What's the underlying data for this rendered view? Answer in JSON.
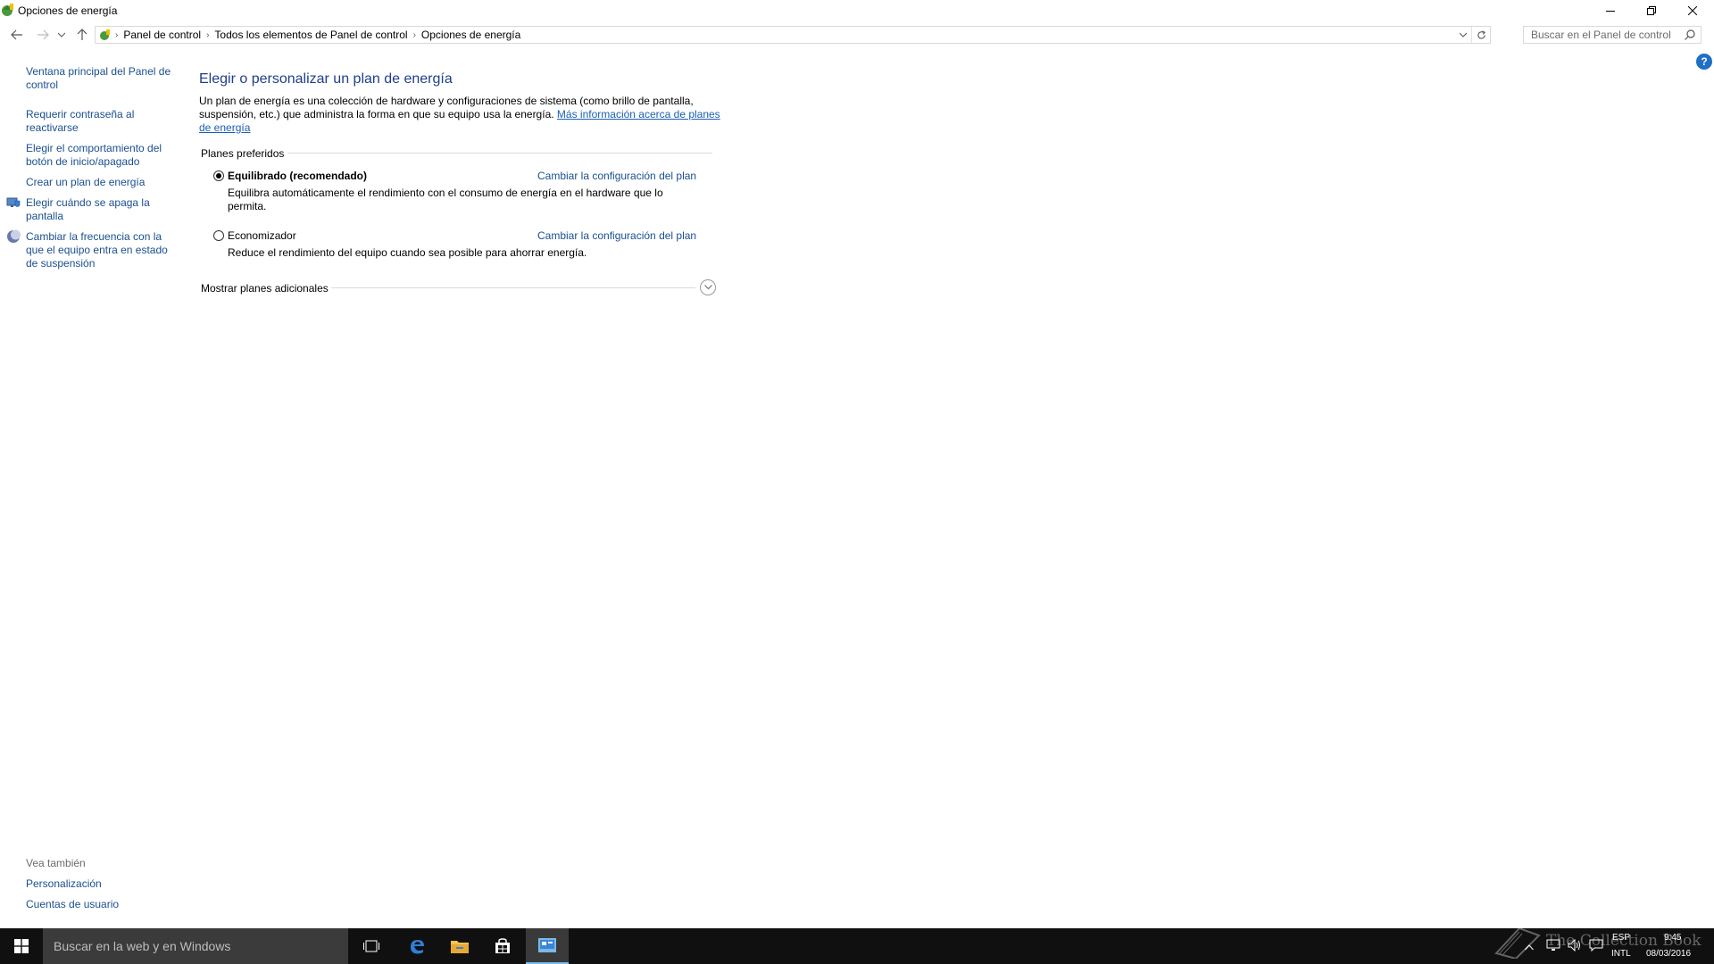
{
  "window": {
    "title": "Opciones de energía",
    "controls": {
      "minimize": "minimize-icon",
      "restore": "restore-icon",
      "close": "close-icon"
    }
  },
  "address_bar": {
    "breadcrumbs": [
      "Panel de control",
      "Todos los elementos de Panel de control",
      "Opciones de energía"
    ],
    "search_placeholder": "Buscar en el Panel de control"
  },
  "left_panel": {
    "links": [
      {
        "label": "Ventana principal del Panel de control"
      },
      {
        "label": "Requerir contraseña al reactivarse"
      },
      {
        "label": "Elegir el comportamiento del botón de inicio/apagado"
      },
      {
        "label": "Crear un plan de energía"
      },
      {
        "label": "Elegir cuándo se apaga la pantalla",
        "icon": "monitor-shield-icon"
      },
      {
        "label": "Cambiar la frecuencia con la que el equipo entra en estado de suspensión",
        "icon": "moon-icon"
      }
    ],
    "see_also": {
      "title": "Vea también",
      "links": [
        "Personalización",
        "Cuentas de usuario"
      ]
    }
  },
  "main": {
    "title": "Elegir o personalizar un plan de energía",
    "intro": "Un plan de energía es una colección de hardware y configuraciones de sistema (como brillo de pantalla, suspensión, etc.) que administra la forma en que su equipo usa la energía.",
    "intro_link": "Más información acerca de planes de energía",
    "preferred_plans_header": "Planes preferidos",
    "plans": [
      {
        "name": "Equilibrado (recomendado)",
        "selected": true,
        "description": "Equilibra automáticamente el rendimiento con el consumo de energía en el hardware que lo permita.",
        "link": "Cambiar la configuración del plan"
      },
      {
        "name": "Economizador",
        "selected": false,
        "description": "Reduce el rendimiento del equipo cuando sea posible para ahorrar energía.",
        "link": "Cambiar la configuración del plan"
      }
    ],
    "additional_plans": "Mostrar planes adicionales"
  },
  "taskbar": {
    "search_placeholder": "Buscar en la web y en Windows",
    "apps": [
      "task-view-icon",
      "edge-icon",
      "file-explorer-icon",
      "store-icon",
      "control-panel-icon"
    ],
    "tray": {
      "language": "ESP",
      "layout": "INTL",
      "time": "9:45",
      "date": "08/03/2016"
    }
  },
  "watermark": "The Collection Book",
  "colors": {
    "link": "#1a4f8f",
    "title": "#1e3f8a",
    "taskbar": "#101010",
    "accent": "#76b9ed"
  }
}
